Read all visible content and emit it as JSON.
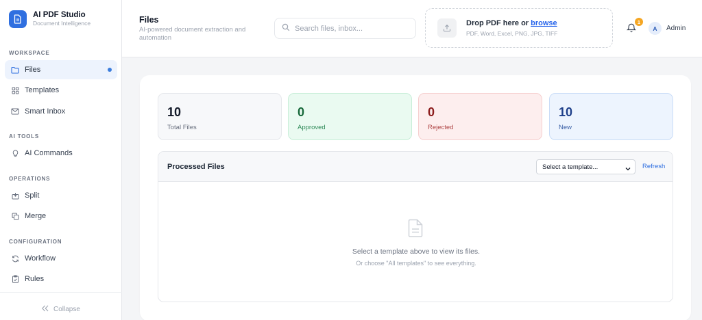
{
  "brand": {
    "title": "AI PDF Studio",
    "subtitle": "Document Intelligence"
  },
  "sidebar": {
    "sections": [
      {
        "label": "WORKSPACE"
      },
      {
        "label": "AI TOOLS"
      },
      {
        "label": "OPERATIONS"
      },
      {
        "label": "CONFIGURATION"
      }
    ],
    "items": [
      {
        "label": "Files",
        "icon": "folder-icon",
        "active": true
      },
      {
        "label": "Templates",
        "icon": "grid-icon"
      },
      {
        "label": "Smart Inbox",
        "icon": "mail-icon"
      },
      {
        "label": "AI Commands",
        "icon": "lightbulb-icon"
      },
      {
        "label": "Split",
        "icon": "split-icon"
      },
      {
        "label": "Merge",
        "icon": "copy-icon"
      },
      {
        "label": "Workflow",
        "icon": "refresh-icon"
      },
      {
        "label": "Rules",
        "icon": "clipboard-icon"
      }
    ],
    "collapse_label": "Collapse"
  },
  "header": {
    "title": "Files",
    "subtitle": "AI-powered document extraction and automation",
    "search_placeholder": "Search files, inbox...",
    "drop_title_prefix": "Drop PDF here or ",
    "drop_link": "browse",
    "drop_formats": "PDF, Word, Excel, PNG, JPG, TIFF",
    "notification_count": "1",
    "user_initial": "A",
    "user_name": "Admin"
  },
  "stats": [
    {
      "value": "10",
      "label": "Total Files"
    },
    {
      "value": "0",
      "label": "Approved"
    },
    {
      "value": "0",
      "label": "Rejected"
    },
    {
      "value": "10",
      "label": "New"
    }
  ],
  "panel": {
    "title": "Processed Files",
    "select_value": "Select a template...",
    "refresh_label": "Refresh",
    "empty_main": "Select a template above to view its files.",
    "empty_sub": "Or choose \"All templates\" to see everything."
  },
  "colors": {
    "accent": "#2f6fe0",
    "approved": "#17683a",
    "rejected": "#8c1d1d",
    "new": "#1e3f8a",
    "badge": "#f5a623"
  }
}
